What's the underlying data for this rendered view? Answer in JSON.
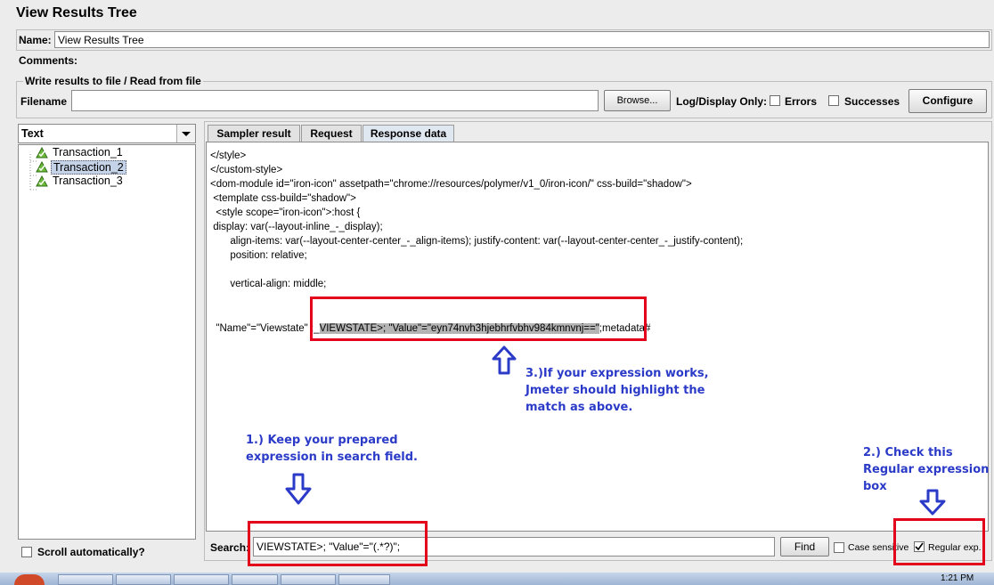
{
  "window": {
    "title": "View Results Tree"
  },
  "name_row": {
    "label": "Name:",
    "value": "View Results Tree"
  },
  "comments_row": {
    "label": "Comments:"
  },
  "file_group": {
    "legend": "Write results to file / Read from file",
    "filename_label": "Filename",
    "filename_value": "",
    "browse_label": "Browse...",
    "log_display_label": "Log/Display Only:",
    "errors_label": "Errors",
    "successes_label": "Successes",
    "configure_label": "Configure"
  },
  "left_panel": {
    "renderer_selected": "Text",
    "tree_items": [
      {
        "label": "Transaction_1",
        "selected": false
      },
      {
        "label": "Transaction_2",
        "selected": true
      },
      {
        "label": "Transaction_3",
        "selected": false
      }
    ],
    "scroll_auto_label": "Scroll automatically?"
  },
  "tabs": [
    {
      "label": "Sampler result",
      "active": false
    },
    {
      "label": "Request",
      "active": false
    },
    {
      "label": "Response data",
      "active": true
    }
  ],
  "response_lines": [
    "</style>",
    "</custom-style>",
    "<dom-module id=\"iron-icon\" assetpath=\"chrome://resources/polymer/v1_0/iron-icon/\" css-build=\"shadow\">",
    " <template css-build=\"shadow\">",
    "  <style scope=\"iron-icon\">:host {",
    " display: var(--layout-inline_-_display);",
    "       align-items: var(--layout-center-center_-_align-items); justify-content: var(--layout-center-center_-_justify-content);",
    "       position: relative;",
    "",
    "       vertical-align: middle;",
    ""
  ],
  "match_line": {
    "before": "\"Name\"=\"Viewstate\" ;_",
    "highlight": "VIEWSTATE>; \"Value\"=\"eyn74nvh3hjebhrfvbhv984kmnvnj==\"",
    "after": ";metadata#"
  },
  "search": {
    "label": "Search:",
    "value": "VIEWSTATE>; \"Value\"=\"(.*?)\";",
    "find_label": "Find",
    "case_sensitive_label": "Case sensitive",
    "regex_label": "Regular exp.",
    "regex_checked": true,
    "case_sensitive_checked": false
  },
  "annotations": {
    "note1": [
      "1.) Keep your prepared",
      "expression in search field."
    ],
    "note2": [
      "2.) Check this",
      "Regular expression",
      "box"
    ],
    "note3": [
      "3.)If your expression works,",
      "Jmeter should highlight the",
      "match as above."
    ]
  },
  "clock": {
    "time": "1:21 PM"
  },
  "colors": {
    "annotation_blue": "#2b3bc8",
    "annotation_red": "#e2001a",
    "selection": "#c5d3e8",
    "highlight": "#b4b4b4"
  }
}
